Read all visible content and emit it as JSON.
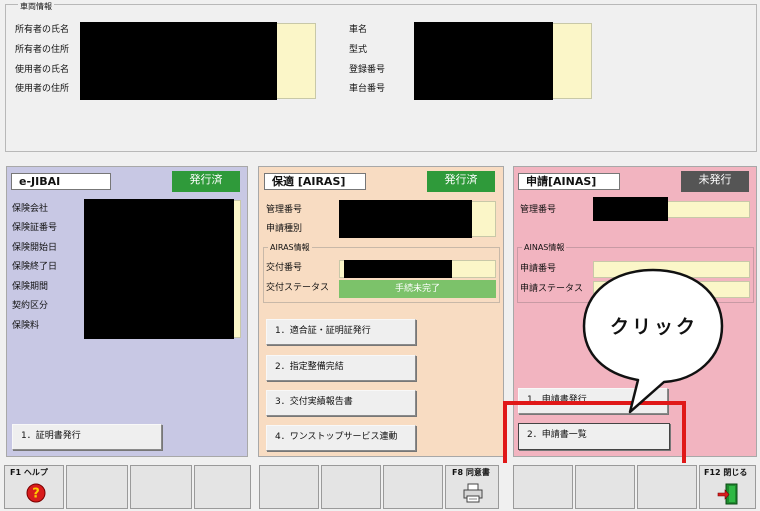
{
  "vehicle_info": {
    "legend": "車両情報",
    "owner_name_label": "所有者の氏名",
    "owner_address_label": "所有者の住所",
    "user_name_label": "使用者の氏名",
    "user_address_label": "使用者の住所",
    "car_name_label": "車名",
    "model_label": "型式",
    "registration_number_label": "登録番号",
    "chassis_number_label": "車台番号"
  },
  "ejibai": {
    "title": "e-JIBAI",
    "status": "発行済",
    "labels": [
      "保険会社",
      "保険証番号",
      "保険開始日",
      "保険終了日",
      "保険期間",
      "契約区分",
      "保険料"
    ],
    "button": "1．証明書発行"
  },
  "airas": {
    "title": "保適 [AIRAS]",
    "status": "発行済",
    "management_number_label": "管理番号",
    "application_type_label": "申請種別",
    "info_legend": "AIRAS情報",
    "delivery_number_label": "交付番号",
    "delivery_status_label": "交付ステータス",
    "delivery_status_value": "手続未完了",
    "buttons": [
      "1．適合証・証明証発行",
      "2．指定整備完結",
      "3．交付実績報告書",
      "4．ワンストップサービス連動"
    ]
  },
  "ainas": {
    "title": "申請[AINAS]",
    "status": "未発行",
    "management_number_label": "管理番号",
    "info_legend": "AINAS情報",
    "application_number_label": "申請番号",
    "application_status_label": "申請ステータス",
    "buttons": [
      "1．申請書発行",
      "2．申請書一覧"
    ]
  },
  "callout": {
    "text": "クリック"
  },
  "function_keys": {
    "f1_label": "F1 ヘルプ",
    "f8_label": "F8 同意書",
    "f12_label": "F12 閉じる"
  },
  "colors": {
    "issued_badge": "#2f9a3a",
    "unissued_badge": "#555555",
    "status_green": "#7cc26a",
    "highlight": "#e01818",
    "ejibai_panel": "#c8c8e4",
    "airas_panel": "#f8dcc2",
    "ainas_panel": "#f2b4c0"
  }
}
